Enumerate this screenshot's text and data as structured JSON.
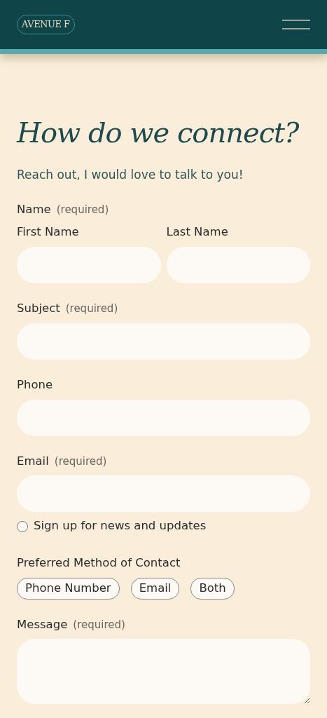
{
  "header": {
    "logo_text": "AVENUE F"
  },
  "heading": "How do we connect?",
  "intro": "Reach out, I would love to talk to you!",
  "name_field": {
    "label": "Name",
    "note": "(required)",
    "parts": [
      {
        "label": "First Name"
      },
      {
        "label": "Last Name"
      }
    ]
  },
  "fields": [
    {
      "kind": "input",
      "label": "Subject",
      "note": "(required)"
    },
    {
      "kind": "input",
      "label": "Phone"
    },
    {
      "kind": "input",
      "label": "Email",
      "note": "(required)"
    }
  ],
  "newsletter": {
    "label": "Sign up for news and updates",
    "checked": false
  },
  "contact_method": {
    "label": "Preferred Method of Contact",
    "options": [
      {
        "label": "Phone Number",
        "selected": false
      },
      {
        "label": "Email",
        "selected": false
      },
      {
        "label": "Both",
        "selected": false
      }
    ]
  },
  "message": {
    "label": "Message",
    "note": "(required)"
  }
}
